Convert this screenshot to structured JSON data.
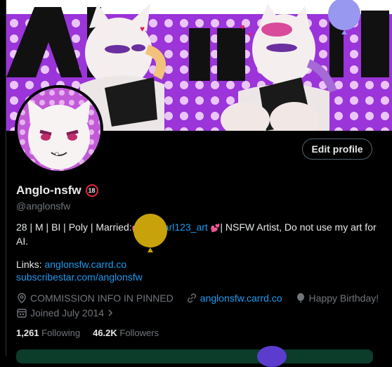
{
  "profile": {
    "display_name": "Anglo-nsfw",
    "age_badge": "18",
    "handle": "@anglonsfw",
    "edit_button": "Edit profile",
    "bio": {
      "part1": "28 | M | BI | Poly | Married:",
      "mention": "@Pearl123_art",
      "part2": "| NSFW Artist,  Do not use my art for",
      "line2": "AI."
    },
    "links_label": "Links: ",
    "link1": "anglonsfw.carrd.co",
    "link2": "subscribestar.com/anglonsfw",
    "meta": {
      "location": "COMMISSION INFO IN PINNED",
      "website": "anglonsfw.carrd.co",
      "birthday": "Happy Birthday!",
      "joined": "Joined July 2014"
    },
    "following_count": "1,261",
    "following_label": "Following",
    "followers_count": "46.2K",
    "followers_label": "Followers"
  },
  "banner": {
    "text": "ANGLO"
  },
  "colors": {
    "accent_link": "#1d9bf0",
    "muted": "#71767b",
    "banner_purple": "#a43de0",
    "heart": "#e0245e"
  }
}
